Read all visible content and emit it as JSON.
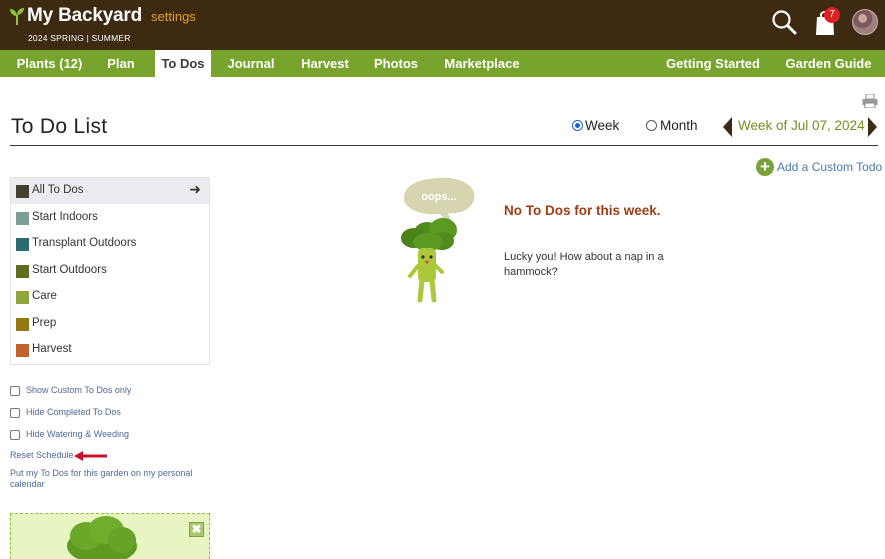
{
  "header": {
    "app_title": "My Backyard",
    "settings_label": "settings",
    "season_label": "2024 SPRING | SUMMER",
    "cart_count": "7"
  },
  "nav": {
    "left_tabs": [
      "Plants (12)",
      "Plan",
      "To Dos",
      "Journal",
      "Harvest",
      "Photos",
      "Marketplace"
    ],
    "right_tabs": [
      "Getting Started",
      "Garden Guide"
    ],
    "active_tab": "To Dos"
  },
  "page": {
    "title": "To Do List",
    "view_options": [
      "Week",
      "Month"
    ],
    "selected_view": "Week",
    "week_label": "Week of  Jul 07, 2024",
    "add_custom_label": "Add a Custom Todo"
  },
  "categories": [
    {
      "label": "All To Dos",
      "color": "#46412e",
      "active": true
    },
    {
      "label": "Start Indoors",
      "color": "#7f9e99"
    },
    {
      "label": "Transplant Outdoors",
      "color": "#2b6a6e"
    },
    {
      "label": "Start Outdoors",
      "color": "#5e6e1f"
    },
    {
      "label": "Care",
      "color": "#8fa63d"
    },
    {
      "label": "Prep",
      "color": "#917a12"
    },
    {
      "label": "Harvest",
      "color": "#c0622c"
    }
  ],
  "options": {
    "show_custom_only": "Show Custom To Dos only",
    "hide_completed": "Hide Completed To Dos",
    "hide_watering": "Hide Watering & Weeding",
    "reset_schedule": "Reset Schedule",
    "calendar_link": "Put my To Dos for this garden on my personal calendar"
  },
  "empty_state": {
    "bubble_text": "oops...",
    "title": "No To Dos for this week.",
    "message": "Lucky you! How about a nap in a hammock?"
  },
  "colors": {
    "header_bg": "#3d2a10",
    "nav_bg": "#76a42d",
    "accent_orange": "#e3a32e",
    "link_blue": "#4a7ba6"
  }
}
